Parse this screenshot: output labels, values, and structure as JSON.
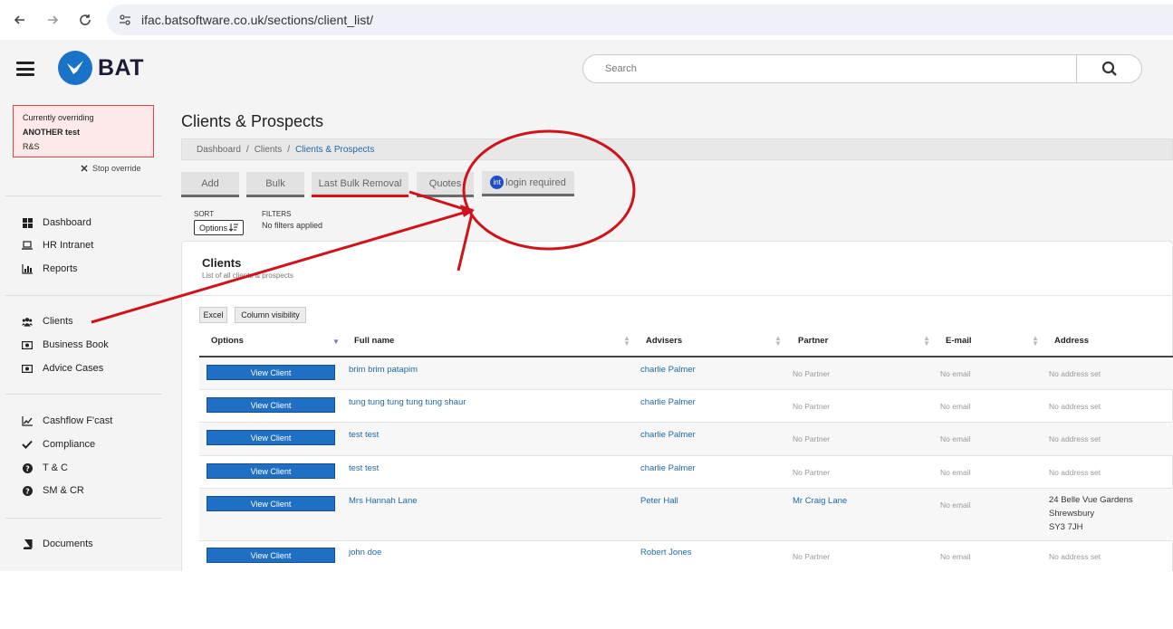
{
  "browser": {
    "url": "ifac.batsoftware.co.uk/sections/client_list/"
  },
  "header": {
    "logo_text": "BAT",
    "search_placeholder": "Search"
  },
  "override": {
    "line1": "Currently overriding",
    "line2": "ANOTHER test",
    "line3": "R&S",
    "stop_label": "Stop override"
  },
  "sidebar": {
    "group1": [
      {
        "label": "Dashboard",
        "icon": "dashboard-icon"
      },
      {
        "label": "HR Intranet",
        "icon": "laptop-icon"
      },
      {
        "label": "Reports",
        "icon": "bar-chart-icon"
      }
    ],
    "group2": [
      {
        "label": "Clients",
        "icon": "users-icon"
      },
      {
        "label": "Business Book",
        "icon": "money-icon"
      },
      {
        "label": "Advice Cases",
        "icon": "money-icon"
      }
    ],
    "group3": [
      {
        "label": "Cashflow F'cast",
        "icon": "line-chart-icon"
      },
      {
        "label": "Compliance",
        "icon": "check-icon"
      },
      {
        "label": "T & C",
        "icon": "question-icon"
      },
      {
        "label": "SM & CR",
        "icon": "question-icon"
      }
    ],
    "group4": [
      {
        "label": "Documents",
        "icon": "book-icon"
      }
    ]
  },
  "page": {
    "title": "Clients & Prospects",
    "breadcrumb": [
      "Dashboard",
      "/",
      "Clients",
      "/",
      "Clients & Prospects"
    ]
  },
  "actions": {
    "add": "Add",
    "bulk": "Bulk",
    "last_bulk_removal": "Last Bulk Removal",
    "quotes": "Quotes",
    "int_badge": "int",
    "login_required": "login required"
  },
  "sort": {
    "label": "SORT",
    "button": "Options"
  },
  "filters": {
    "label": "FILTERS",
    "value": "No filters applied"
  },
  "panel": {
    "title": "Clients",
    "subtitle": "List of all clients & prospects",
    "excel": "Excel",
    "column_visibility": "Column visibility"
  },
  "table": {
    "headers": [
      "Options",
      "Full name",
      "Advisers",
      "Partner",
      "E-mail",
      "Address"
    ],
    "view_label": "View Client",
    "rows": [
      {
        "name": "brim brim patapim",
        "adviser": "charlie Palmer",
        "partner": "No Partner",
        "email": "No email",
        "address": [
          "No address set"
        ]
      },
      {
        "name": "tung tung tung tung tung shaur",
        "adviser": "charlie Palmer",
        "partner": "No Partner",
        "email": "No email",
        "address": [
          "No address set"
        ]
      },
      {
        "name": "test test",
        "adviser": "charlie Palmer",
        "partner": "No Partner",
        "email": "No email",
        "address": [
          "No address set"
        ]
      },
      {
        "name": "test test",
        "adviser": "charlie Palmer",
        "partner": "No Partner",
        "email": "No email",
        "address": [
          "No address set"
        ]
      },
      {
        "name": "Mrs Hannah Lane",
        "adviser": "Peter Hall",
        "partner": "Mr Craig Lane",
        "email": "No email",
        "address": [
          "24 Belle Vue Gardens",
          "Shrewsbury",
          "SY3 7JH"
        ]
      },
      {
        "name": "john doe",
        "adviser": "Robert Jones",
        "partner": "No Partner",
        "email": "No email",
        "address": [
          "No address set"
        ]
      }
    ]
  },
  "colors": {
    "brand_blue": "#1a73c9",
    "button_blue": "#1f6fc5",
    "annotation_red": "#d0121b",
    "override_bg": "#fde9ea"
  }
}
